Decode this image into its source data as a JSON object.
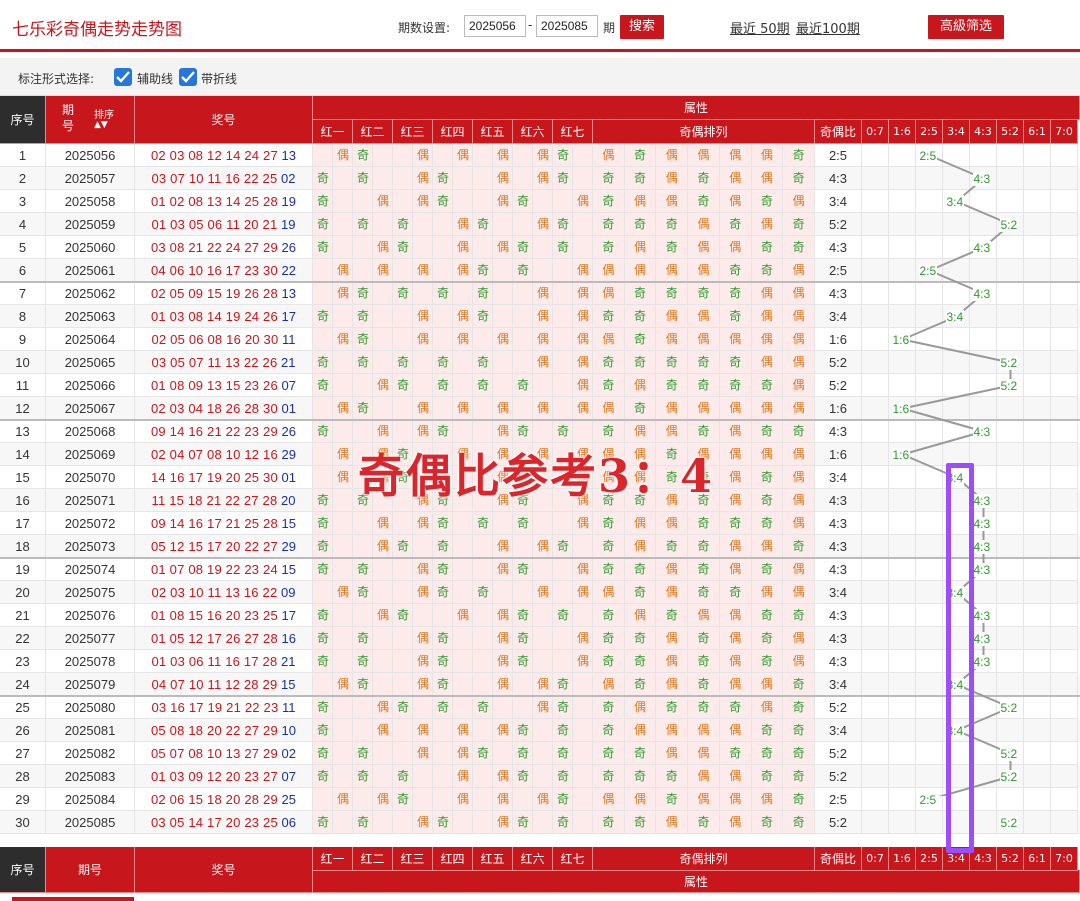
{
  "header": {
    "title": "七乐彩奇偶走势走势图",
    "period_label": "期数设置:",
    "start_period": "2025056",
    "end_period": "2025085",
    "dash": "-",
    "qi": "期",
    "search_btn": "搜索",
    "recent50": "最近 50期",
    "recent100": "最近100期",
    "advanced_btn": "高級筛选"
  },
  "options": {
    "label": "标注形式选择:",
    "aux_line": "辅助线",
    "fold_line": "带折线"
  },
  "columns": {
    "seq": "序号",
    "period": "期号",
    "sort": "排序",
    "award": "奖号",
    "attr": "属性",
    "reds": [
      "红一",
      "红二",
      "红三",
      "红四",
      "红五",
      "红六",
      "红七"
    ],
    "parity_arrange": "奇偶排列",
    "ratio": "奇偶比",
    "ratios": [
      "0:7",
      "1:6",
      "2:5",
      "3:4",
      "4:3",
      "5:2",
      "6:1",
      "7:0"
    ]
  },
  "rows": [
    {
      "seq": "1",
      "period": "2025056",
      "nums": "02 03 08 12 14 24 27",
      "special": "13",
      "ratio": "2:5"
    },
    {
      "seq": "2",
      "period": "2025057",
      "nums": "03 07 10 11 16 22 25",
      "special": "02",
      "ratio": "4:3"
    },
    {
      "seq": "3",
      "period": "2025058",
      "nums": "01 02 08 13 14 25 28",
      "special": "19",
      "ratio": "3:4"
    },
    {
      "seq": "4",
      "period": "2025059",
      "nums": "01 03 05 06 11 20 21",
      "special": "19",
      "ratio": "5:2"
    },
    {
      "seq": "5",
      "period": "2025060",
      "nums": "03 08 21 22 24 27 29",
      "special": "26",
      "ratio": "4:3"
    },
    {
      "seq": "6",
      "period": "2025061",
      "nums": "04 06 10 16 17 23 30",
      "special": "22",
      "ratio": "2:5"
    },
    {
      "seq": "7",
      "period": "2025062",
      "nums": "02 05 09 15 19 26 28",
      "special": "13",
      "ratio": "4:3"
    },
    {
      "seq": "8",
      "period": "2025063",
      "nums": "01 03 08 14 19 24 26",
      "special": "17",
      "ratio": "3:4"
    },
    {
      "seq": "9",
      "period": "2025064",
      "nums": "02 05 06 08 16 20 30",
      "special": "11",
      "ratio": "1:6"
    },
    {
      "seq": "10",
      "period": "2025065",
      "nums": "03 05 07 11 13 22 26",
      "special": "21",
      "ratio": "5:2"
    },
    {
      "seq": "11",
      "period": "2025066",
      "nums": "01 08 09 13 15 23 26",
      "special": "07",
      "ratio": "5:2"
    },
    {
      "seq": "12",
      "period": "2025067",
      "nums": "02 03 04 18 26 28 30",
      "special": "01",
      "ratio": "1:6"
    },
    {
      "seq": "13",
      "period": "2025068",
      "nums": "09 14 16 21 22 23 29",
      "special": "26",
      "ratio": "4:3"
    },
    {
      "seq": "14",
      "period": "2025069",
      "nums": "02 04 07 08 10 12 16",
      "special": "29",
      "ratio": "1:6"
    },
    {
      "seq": "15",
      "period": "2025070",
      "nums": "14 16 17 19 20 25 30",
      "special": "01",
      "ratio": "3:4"
    },
    {
      "seq": "16",
      "period": "2025071",
      "nums": "11 15 18 21 22 27 28",
      "special": "20",
      "ratio": "4:3"
    },
    {
      "seq": "17",
      "period": "2025072",
      "nums": "09 14 16 17 21 25 28",
      "special": "15",
      "ratio": "4:3"
    },
    {
      "seq": "18",
      "period": "2025073",
      "nums": "05 12 15 17 20 22 27",
      "special": "29",
      "ratio": "4:3"
    },
    {
      "seq": "19",
      "period": "2025074",
      "nums": "01 07 08 19 22 23 24",
      "special": "15",
      "ratio": "4:3"
    },
    {
      "seq": "20",
      "period": "2025075",
      "nums": "02 03 10 11 13 16 22",
      "special": "09",
      "ratio": "3:4"
    },
    {
      "seq": "21",
      "period": "2025076",
      "nums": "01 08 15 16 20 23 25",
      "special": "17",
      "ratio": "4:3"
    },
    {
      "seq": "22",
      "period": "2025077",
      "nums": "01 05 12 17 26 27 28",
      "special": "16",
      "ratio": "4:3"
    },
    {
      "seq": "23",
      "period": "2025078",
      "nums": "01 03 06 11 16 17 28",
      "special": "21",
      "ratio": "4:3"
    },
    {
      "seq": "24",
      "period": "2025079",
      "nums": "04 07 10 11 12 28 29",
      "special": "15",
      "ratio": "3:4"
    },
    {
      "seq": "25",
      "period": "2025080",
      "nums": "03 16 17 19 21 22 23",
      "special": "11",
      "ratio": "5:2"
    },
    {
      "seq": "26",
      "period": "2025081",
      "nums": "05 08 18 20 22 27 29",
      "special": "10",
      "ratio": "3:4"
    },
    {
      "seq": "27",
      "period": "2025082",
      "nums": "05 07 08 10 13 27 29",
      "special": "02",
      "ratio": "5:2"
    },
    {
      "seq": "28",
      "period": "2025083",
      "nums": "01 03 09 12 20 23 27",
      "special": "07",
      "ratio": "5:2"
    },
    {
      "seq": "29",
      "period": "2025084",
      "nums": "02 06 15 18 20 28 29",
      "special": "25",
      "ratio": "2:5"
    },
    {
      "seq": "30",
      "period": "2025085",
      "nums": "03 05 14 17 20 23 25",
      "special": "06",
      "ratio": "5:2"
    }
  ],
  "symbols": {
    "odd": "奇",
    "even": "偶"
  },
  "watermark": "奇偶比参考3：4",
  "colors": {
    "accent": "#c8161d",
    "odd": "#2e9a2e",
    "even": "#e07a1f",
    "highlight": "#9b4dff"
  }
}
